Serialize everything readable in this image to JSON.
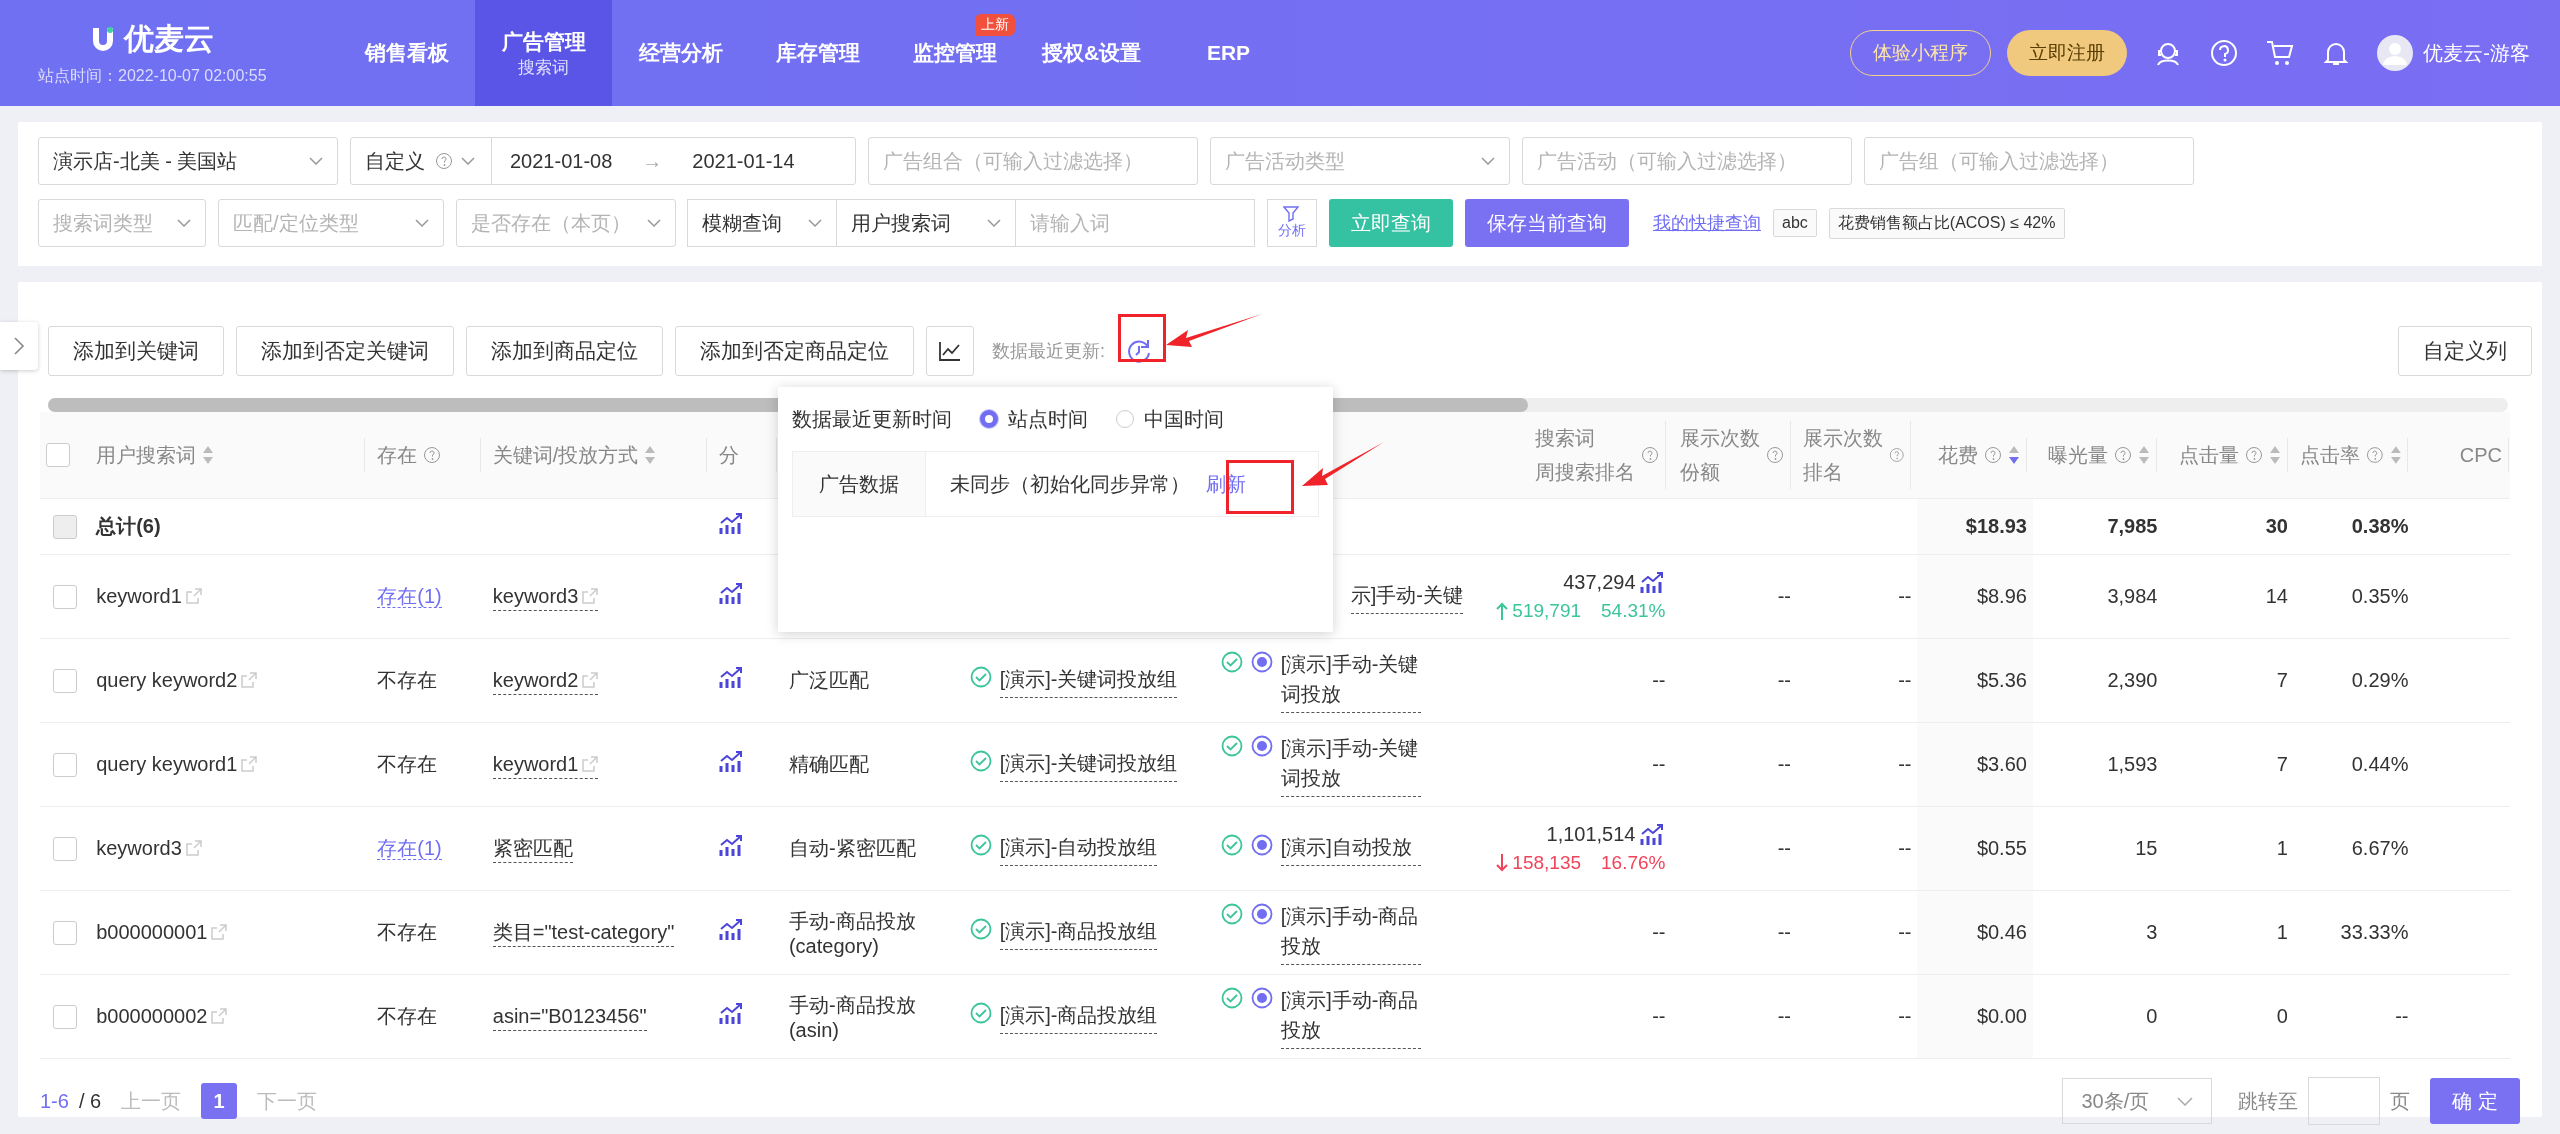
{
  "nav": {
    "logo": "优麦云",
    "site_time": "站点时间：2022-10-07 02:00:55",
    "menu": [
      {
        "label": "销售看板",
        "selected": false
      },
      {
        "label": "广告管理",
        "selected": true,
        "sub": "搜索词"
      },
      {
        "label": "经营分析",
        "selected": false
      },
      {
        "label": "库存管理",
        "selected": false
      },
      {
        "label": "监控管理",
        "selected": false,
        "badge": "上新"
      },
      {
        "label": "授权&设置",
        "selected": false
      },
      {
        "label": "ERP",
        "selected": false
      }
    ],
    "mini_program_button": "体验小程序",
    "register_button": "立即注册",
    "user": "优麦云-游客"
  },
  "filters": {
    "row1": [
      {
        "kind": "select",
        "value": "演示店-北美 - 美国站"
      },
      {
        "kind": "daterange",
        "mode": "自定义",
        "start": "2021-01-08",
        "arrow": "→",
        "end": "2021-01-14"
      },
      {
        "kind": "input",
        "placeholder": "广告组合（可输入过滤选择）"
      },
      {
        "kind": "select",
        "placeholder": "广告活动类型"
      },
      {
        "kind": "input",
        "placeholder": "广告活动（可输入过滤选择）"
      },
      {
        "kind": "input",
        "placeholder": "广告组（可输入过滤选择）"
      }
    ],
    "row2": [
      {
        "kind": "select",
        "placeholder": "搜索词类型"
      },
      {
        "kind": "select",
        "placeholder": "匹配/定位类型"
      },
      {
        "kind": "select",
        "placeholder": "是否存在（本页）"
      },
      {
        "kind": "combo",
        "mode": "模糊查询",
        "field": "用户搜索词",
        "placeholder": "请输入词"
      }
    ],
    "analyze_button": "分析",
    "query_button": "立即查询",
    "save_button": "保存当前查询",
    "quick_link": "我的快捷查询",
    "tags": [
      "abc",
      "花费销售额占比(ACOS) ≤ 42%"
    ]
  },
  "toolbar": {
    "buttons": [
      "添加到关键词",
      "添加到否定关键词",
      "添加到商品定位",
      "添加到否定商品定位"
    ],
    "update_label": "数据最近更新:",
    "columns_button": "自定义列"
  },
  "popup": {
    "title": "数据最近更新时间",
    "options": [
      {
        "label": "站点时间",
        "selected": true
      },
      {
        "label": "中国时间",
        "selected": false
      }
    ],
    "row": {
      "name": "广告数据",
      "status": "未同步（初始化同步异常）",
      "action": "刷新"
    }
  },
  "table": {
    "select_all_checked": false,
    "columns": [
      {
        "label": "用户搜索词",
        "sortable": true
      },
      {
        "label": "存在",
        "help": true
      },
      {
        "label": "关键词/投放方式",
        "sortable": true
      },
      {
        "label": "分"
      },
      {},
      {},
      {},
      {
        "label": "搜索词",
        "label2": "周搜索排名",
        "help": true
      },
      {
        "label": "展示次数",
        "label2": "份额",
        "help": true
      },
      {
        "label": "展示次数",
        "label2": "排名",
        "help": true
      },
      {
        "label": "花费",
        "help": true,
        "sortable": true,
        "sorted": true
      },
      {
        "label": "曝光量",
        "help": true,
        "sortable": true
      },
      {
        "label": "点击量",
        "help": true,
        "sortable": true
      },
      {
        "label": "点击率",
        "help": true,
        "sortable": true
      },
      {
        "label": "CPC"
      }
    ],
    "total": {
      "checked": false,
      "disabled": true,
      "label": "总计(6)",
      "cost": "$18.93",
      "impressions": "7,985",
      "clicks": "30",
      "ctr": "0.38%"
    },
    "rows": [
      {
        "checked": false,
        "term": "keyword1",
        "exist": {
          "kind": "link",
          "text": "存在(1)"
        },
        "keyword": "keyword3",
        "keyword_link": true,
        "campaign": "示]手动-关键",
        "rank": {
          "value": "437,294",
          "change": {
            "increase": true,
            "value": "519,791",
            "pct": "54.31%"
          }
        },
        "share": "--",
        "irank": "--",
        "cost": "$8.96",
        "impressions": "3,984",
        "clicks": "14",
        "ctr": "0.35%"
      },
      {
        "checked": false,
        "term": "query keyword2",
        "exist": {
          "kind": "plain",
          "text": "不存在"
        },
        "keyword": "keyword2",
        "keyword_link": true,
        "match": [
          "广泛匹配"
        ],
        "group": "[演示]-关键词投放组",
        "campaign": "[演示]手动-关键词投放",
        "rank": {
          "value": "--"
        },
        "share": "--",
        "irank": "--",
        "cost": "$5.36",
        "impressions": "2,390",
        "clicks": "7",
        "ctr": "0.29%"
      },
      {
        "checked": false,
        "term": "query keyword1",
        "exist": {
          "kind": "plain",
          "text": "不存在"
        },
        "keyword": "keyword1",
        "keyword_link": true,
        "match": [
          "精确匹配"
        ],
        "group": "[演示]-关键词投放组",
        "campaign": "[演示]手动-关键词投放",
        "rank": {
          "value": "--"
        },
        "share": "--",
        "irank": "--",
        "cost": "$3.60",
        "impressions": "1,593",
        "clicks": "7",
        "ctr": "0.44%"
      },
      {
        "checked": false,
        "term": "keyword3",
        "exist": {
          "kind": "link",
          "text": "存在(1)"
        },
        "keyword": "紧密匹配",
        "keyword_link": false,
        "match": [
          "自动-紧密匹配"
        ],
        "group": "[演示]-自动投放组",
        "campaign": "[演示]自动投放",
        "rank": {
          "value": "1,101,514",
          "change": {
            "increase": false,
            "value": "158,135",
            "pct": "16.76%"
          }
        },
        "share": "--",
        "irank": "--",
        "cost": "$0.55",
        "impressions": "15",
        "clicks": "1",
        "ctr": "6.67%"
      },
      {
        "checked": false,
        "term": "b000000001",
        "exist": {
          "kind": "plain",
          "text": "不存在"
        },
        "keyword": "类目=\"test-category\"",
        "keyword_link": false,
        "match": [
          "手动-商品投放",
          "(category)"
        ],
        "group": "[演示]-商品投放组",
        "campaign": "[演示]手动-商品投放",
        "rank": {
          "value": "--"
        },
        "share": "--",
        "irank": "--",
        "cost": "$0.46",
        "impressions": "3",
        "clicks": "1",
        "ctr": "33.33%"
      },
      {
        "checked": false,
        "term": "b000000002",
        "exist": {
          "kind": "plain",
          "text": "不存在"
        },
        "keyword": "asin=\"B0123456\"",
        "keyword_link": false,
        "match": [
          "手动-商品投放",
          "(asin)"
        ],
        "group": "[演示]-商品投放组",
        "campaign": "[演示]手动-商品投放",
        "rank": {
          "value": "--"
        },
        "share": "--",
        "irank": "--",
        "cost": "$0.00",
        "impressions": "0",
        "clicks": "0",
        "ctr": "--"
      }
    ]
  },
  "pagination": {
    "range": "1-6",
    "total": "/ 6",
    "prev": "上一页",
    "pages": [
      {
        "label": "1",
        "selected": true
      }
    ],
    "next": "下一页",
    "page_size": "30条/页",
    "jump_label": "跳转至",
    "page_unit": "页",
    "confirm": "确 定"
  }
}
